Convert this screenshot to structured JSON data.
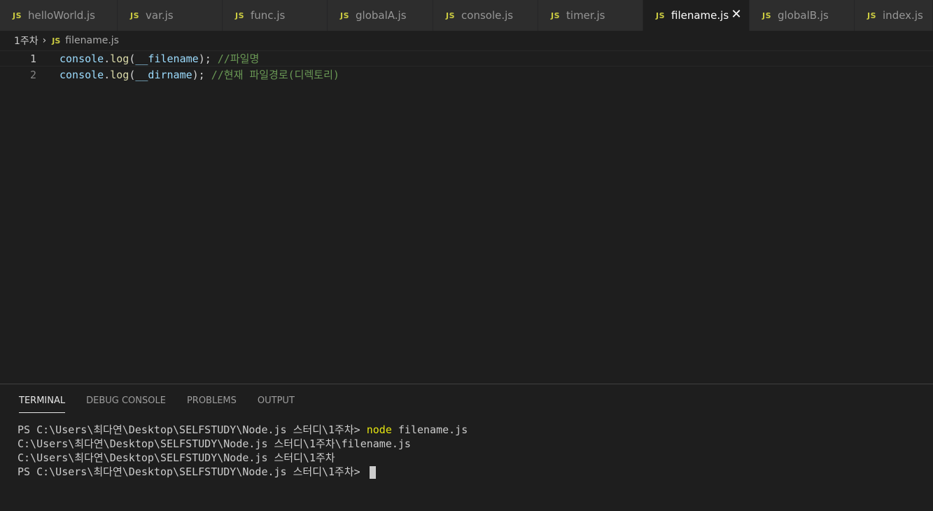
{
  "tabs": [
    {
      "icon": "JS",
      "label": "helloWorld.js",
      "active": false
    },
    {
      "icon": "JS",
      "label": "var.js",
      "active": false
    },
    {
      "icon": "JS",
      "label": "func.js",
      "active": false
    },
    {
      "icon": "JS",
      "label": "globalA.js",
      "active": false
    },
    {
      "icon": "JS",
      "label": "console.js",
      "active": false
    },
    {
      "icon": "JS",
      "label": "timer.js",
      "active": false
    },
    {
      "icon": "JS",
      "label": "filename.js",
      "active": true,
      "close": "✕"
    },
    {
      "icon": "JS",
      "label": "globalB.js",
      "active": false
    },
    {
      "icon": "JS",
      "label": "index.js",
      "active": false
    }
  ],
  "breadcrumb": {
    "folder": "1주차",
    "separator": "›",
    "icon": "JS",
    "file": "filename.js"
  },
  "editor": {
    "lines": [
      {
        "number": "1",
        "obj": "console",
        "dot": ".",
        "fn": "log",
        "open": "(",
        "arg": "__filename",
        "close": ");",
        "comment": "//파일명"
      },
      {
        "number": "2",
        "obj": "console",
        "dot": ".",
        "fn": "log",
        "open": "(",
        "arg": "__dirname",
        "close": ");",
        "comment": "//현재 파일경로(디렉토리)"
      }
    ]
  },
  "panel": {
    "tabs": [
      "TERMINAL",
      "DEBUG CONSOLE",
      "PROBLEMS",
      "OUTPUT"
    ],
    "active_tab": "TERMINAL",
    "terminal": {
      "prompt1": "PS C:\\Users\\최다연\\Desktop\\SELFSTUDY\\Node.js 스터디\\1주차> ",
      "command": "node",
      "args": " filename.js",
      "out1": "C:\\Users\\최다연\\Desktop\\SELFSTUDY\\Node.js 스터디\\1주차\\filename.js",
      "out2": "C:\\Users\\최다연\\Desktop\\SELFSTUDY\\Node.js 스터디\\1주차",
      "prompt2": "PS C:\\Users\\최다연\\Desktop\\SELFSTUDY\\Node.js 스터디\\1주차> "
    }
  },
  "colors": {
    "js_icon": "#cbcb41",
    "comment": "#6a9955",
    "variable": "#9cdcfe",
    "function": "#dcdcaa",
    "command": "#e5e510"
  }
}
